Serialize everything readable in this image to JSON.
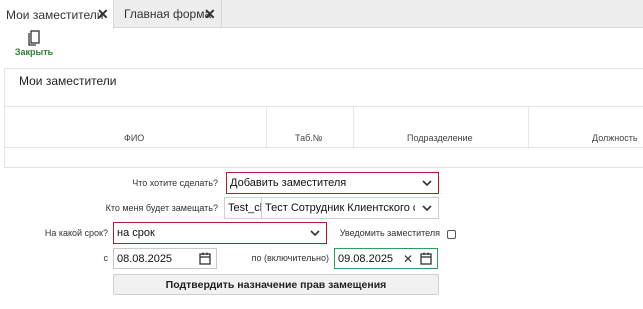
{
  "tabs": [
    {
      "label": "Мои заместители",
      "active": true
    },
    {
      "label": "Главная форма",
      "active": false
    }
  ],
  "toolbar": {
    "close_label": "Закрыть",
    "close_icon": "close-document-icon"
  },
  "panel": {
    "title": "Мои заместители",
    "columns": [
      "ФИО",
      "Таб.№",
      "Подразделение",
      "Должность"
    ]
  },
  "form": {
    "action_label": "Что хотите сделать?",
    "action_value": "Добавить заместителя",
    "substitute_label": "Кто меня будет замещать?",
    "substitute_tab": "Test_cl",
    "substitute_name": "Тест Сотрудник Клиентского се",
    "period_label": "На какой срок?",
    "period_value": "на срок",
    "notify_label": "Уведомить заместителя",
    "notify_checked": false,
    "from_label": "с",
    "from_value": "08.08.2025",
    "to_label": "по (включительно)",
    "to_value": "09.08.2025",
    "confirm_label": "Подтвердить назначение прав замещения"
  },
  "colors": {
    "accent_red": "#b31b2e",
    "accent_green": "#2e9e5b",
    "close_label": "#2e7d32"
  }
}
